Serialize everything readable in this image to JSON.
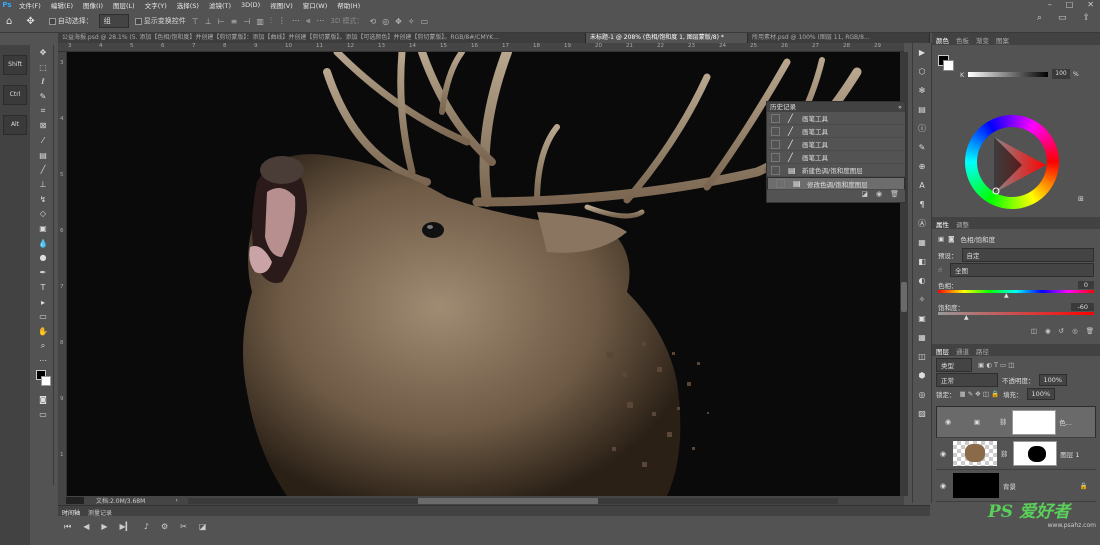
{
  "menubar": {
    "items": [
      "文件(F)",
      "编辑(E)",
      "图像(I)",
      "图层(L)",
      "文字(Y)",
      "选择(S)",
      "滤镜(T)",
      "3D(D)",
      "视图(V)",
      "窗口(W)",
      "帮助(H)"
    ]
  },
  "options": {
    "auto_select": "自动选择：",
    "group": "组",
    "show_transform": "显示变换控件",
    "mode3d": "3D 模式："
  },
  "tabs": [
    "公益海报.psd @ 28.1% (5. 添加【色相/饱和度】并创建【剪切蒙版】：添加【曲线】并创建【剪切蒙版】。添加【可选颜色】并创建【剪切蒙版】。RGB/8#/CMYK...",
    "未标题-1 @ 208% (色相/饱和度 1, 图层蒙版/8) *",
    "所用素材.psd @ 100% (图层 11, RGB/8..."
  ],
  "ruler_top": [
    "3",
    "4",
    "5",
    "6",
    "7",
    "8",
    "9",
    "10",
    "11",
    "12",
    "13",
    "14",
    "15",
    "16",
    "17",
    "18",
    "19",
    "20",
    "21",
    "22",
    "23",
    "24",
    "25",
    "26",
    "27",
    "28",
    "29"
  ],
  "ruler_left": [
    "3",
    "4",
    "5",
    "6",
    "7",
    "8",
    "9",
    "1"
  ],
  "leftkeys": [
    "Shift",
    "Ctrl",
    "Alt"
  ],
  "status": {
    "doc": "文档:2.0M/3.68M"
  },
  "timeline": {
    "tabs": [
      "时间轴",
      "测量记录"
    ]
  },
  "history": {
    "title": "历史记录",
    "items": [
      "画笔工具",
      "画笔工具",
      "画笔工具",
      "画笔工具",
      "新建色调/饱和度图层",
      "修改色调/饱和度图层"
    ]
  },
  "color_panel": {
    "tabs": [
      "颜色",
      "色板",
      "渐变",
      "图案"
    ],
    "channel": "K",
    "value": "100",
    "unit": "%"
  },
  "properties": {
    "tabs": [
      "属性",
      "调整"
    ],
    "type": "色相/饱和度",
    "preset_label": "预设：",
    "preset": "自定",
    "channel": "全图",
    "hue_label": "色相：",
    "hue": "0",
    "sat_label": "饱和度：",
    "sat": "-60",
    "light_label": "明度：",
    "light": "0"
  },
  "layers": {
    "tabs": [
      "图层",
      "通道",
      "路径"
    ],
    "filter": "类型",
    "blend": "正常",
    "opacity_label": "不透明度：",
    "opacity": "100%",
    "lock_label": "锁定：",
    "fill_label": "填充：",
    "fill": "100%",
    "items": [
      {
        "name": "色..."
      },
      {
        "name": "图层 1"
      },
      {
        "name": "背景"
      }
    ]
  },
  "watermark": {
    "text": "PS 爱好者",
    "url": "www.psahz.com"
  },
  "colors": {
    "bg": "#535353",
    "dark": "#424242",
    "canvas": "#0a0a0a",
    "accent": "#31a8ff"
  }
}
